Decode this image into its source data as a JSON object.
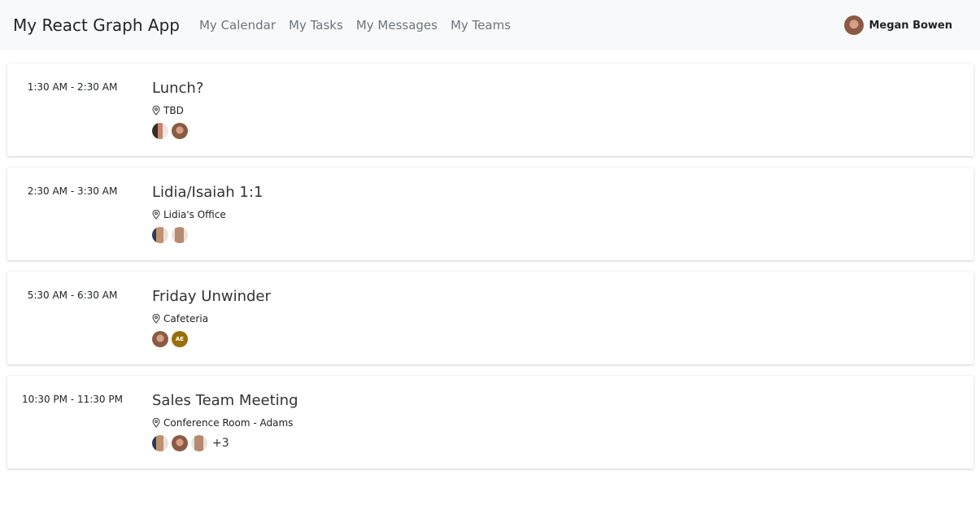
{
  "app": {
    "brand": "My React Graph App",
    "nav": [
      "My Calendar",
      "My Tasks",
      "My Messages",
      "My Teams"
    ],
    "user": {
      "name": "Megan Bowen"
    }
  },
  "events": [
    {
      "time": "1:30 AM - 2:30 AM",
      "subject": "Lunch?",
      "location": "TBD",
      "attendees": [
        "face5",
        "face2"
      ],
      "more": ""
    },
    {
      "time": "2:30 AM - 3:30 AM",
      "subject": "Lidia/Isaiah 1:1",
      "location": "Lidia's Office",
      "attendees": [
        "face3",
        "face4"
      ],
      "more": ""
    },
    {
      "time": "5:30 AM - 6:30 AM",
      "subject": "Friday Unwinder",
      "location": "Cafeteria",
      "attendees": [
        "face2",
        "AE"
      ],
      "more": ""
    },
    {
      "time": "10:30 PM - 11:30 PM",
      "subject": "Sales Team Meeting",
      "location": "Conference Room - Adams",
      "attendees": [
        "face3",
        "face2",
        "face4"
      ],
      "more": "+3"
    }
  ],
  "colors": {
    "navbar_bg": "#f8f9fa",
    "initials_bg": "#986f0b"
  }
}
